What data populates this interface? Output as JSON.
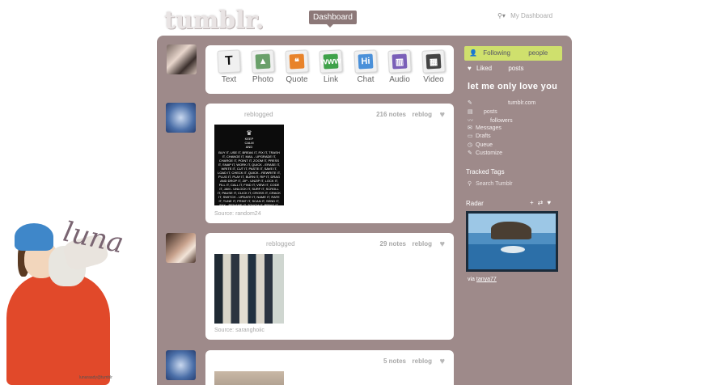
{
  "header": {
    "logo": "tumblr.",
    "dashboard": "Dashboard",
    "my_dashboard": "My Dashboard"
  },
  "composer": {
    "items": [
      {
        "label": "Text",
        "icon": "text-post-icon",
        "color": "#222222",
        "glyph": "T"
      },
      {
        "label": "Photo",
        "icon": "photo-post-icon",
        "color": "#6aa06a",
        "glyph": "▲"
      },
      {
        "label": "Quote",
        "icon": "quote-post-icon",
        "color": "#e8832a",
        "glyph": "❝"
      },
      {
        "label": "Link",
        "icon": "link-post-icon",
        "color": "#3fa24a",
        "glyph": "www"
      },
      {
        "label": "Chat",
        "icon": "chat-post-icon",
        "color": "#4a90d9",
        "glyph": "Hi"
      },
      {
        "label": "Audio",
        "icon": "audio-post-icon",
        "color": "#7a5fb8",
        "glyph": "▥"
      },
      {
        "label": "Video",
        "icon": "video-post-icon",
        "color": "#444444",
        "glyph": "▦"
      }
    ]
  },
  "posts": [
    {
      "reblogged": "reblogged",
      "notes": "216 notes",
      "reblog": "reblog",
      "source": "Source: random24",
      "image_text": {
        "crown": "♛",
        "line1": "KEEP",
        "line2": "CALM",
        "line3": "AND",
        "body": "BUY IT, USE IT, BREAK IT, FIX IT, TRASH IT, CHANGE IT, MAIL - UPGRADE IT, CHARGE IT, POINT IT, ZOOM IT, PRESS IT, SNAP IT, WORK IT, QUICK - ERASE IT, WRITE IT, CUT IT, PASTE IT, SAVE IT, LOAD IT, CHECK IT, QUICK - REWRITE IT, PLUG IT, PLAY IT, BURN IT, RIP IT, DRAG AND DROP IT, ZIP - UNZIP IT, LOCK IT, FILL IT, CALL IT, FIND IT, VIEW IT, CODE IT, JAM - UNLOCK IT, SURF IT, SCROLL IT, PAUSE IT, CLICK IT, CROSS IT, CRACK IT, SWITCH - UPDATE IT, NAME IT, RATE IT, TUNE IT, PRINT IT, SCAN IT, SEND IT, FAX - RENAME IT, TOUCH IT, BRING IT, PAY IT, WATCH IT, TURN IT, LEAVE IT, START - FORMAT IT."
      }
    },
    {
      "reblogged": "reblogged",
      "notes": "29 notes",
      "reblog": "reblog",
      "source": "Source: saranghoiic"
    },
    {
      "reblogged": "",
      "notes": "5 notes",
      "reblog": "reblog"
    }
  ],
  "sidebar": {
    "following": "Following",
    "following_count": "people",
    "liked": "Liked",
    "liked_count": "posts",
    "blog_title": "let me only love you",
    "blog_url": "tumblr.com",
    "links": [
      {
        "label": "posts",
        "icon": "posts-icon"
      },
      {
        "label": "followers",
        "icon": "followers-icon"
      },
      {
        "label": "Messages",
        "icon": "messages-icon"
      },
      {
        "label": "Drafts",
        "icon": "drafts-icon"
      },
      {
        "label": "Queue",
        "icon": "queue-icon"
      },
      {
        "label": "Customize",
        "icon": "customize-icon"
      }
    ],
    "tracked_tags": "Tracked Tags",
    "search_tumblr": "Search Tumblr",
    "radar": "Radar",
    "via_prefix": "via",
    "via_user": "tanya77"
  },
  "background": {
    "signature": "luna",
    "caption": "lunaraady@tumblr"
  }
}
